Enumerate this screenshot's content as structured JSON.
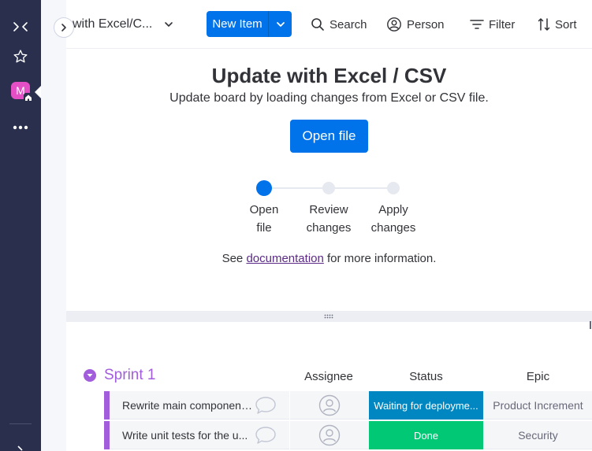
{
  "rail": {
    "badge_letter": "M",
    "accent": "#e44fc6"
  },
  "topbar": {
    "board_title": "with Excel/C...",
    "new_item_label": "New Item",
    "search_label": "Search",
    "person_label": "Person",
    "filter_label": "Filter",
    "sort_label": "Sort"
  },
  "panel": {
    "title": "Update with Excel / CSV",
    "subtitle": "Update board by loading changes from Excel or CSV file.",
    "open_file_label": "Open file",
    "steps": [
      {
        "line1": "Open",
        "line2": "file"
      },
      {
        "line1": "Review",
        "line2": "changes"
      },
      {
        "line1": "Apply",
        "line2": "changes"
      }
    ],
    "doc_prefix": "See ",
    "doc_link": "documentation",
    "doc_suffix": " for more information."
  },
  "group": {
    "name": "Sprint 1",
    "color": "#a25ddc",
    "columns": {
      "assignee": "Assignee",
      "status": "Status",
      "epic": "Epic"
    },
    "rows": [
      {
        "name": "Rewrite main component...",
        "status": "Waiting for deployme...",
        "status_color": "#0086c0",
        "epic": "Product Increment"
      },
      {
        "name": "Write unit tests for the u...",
        "status": "Done",
        "status_color": "#00c875",
        "epic": "Security"
      }
    ]
  }
}
